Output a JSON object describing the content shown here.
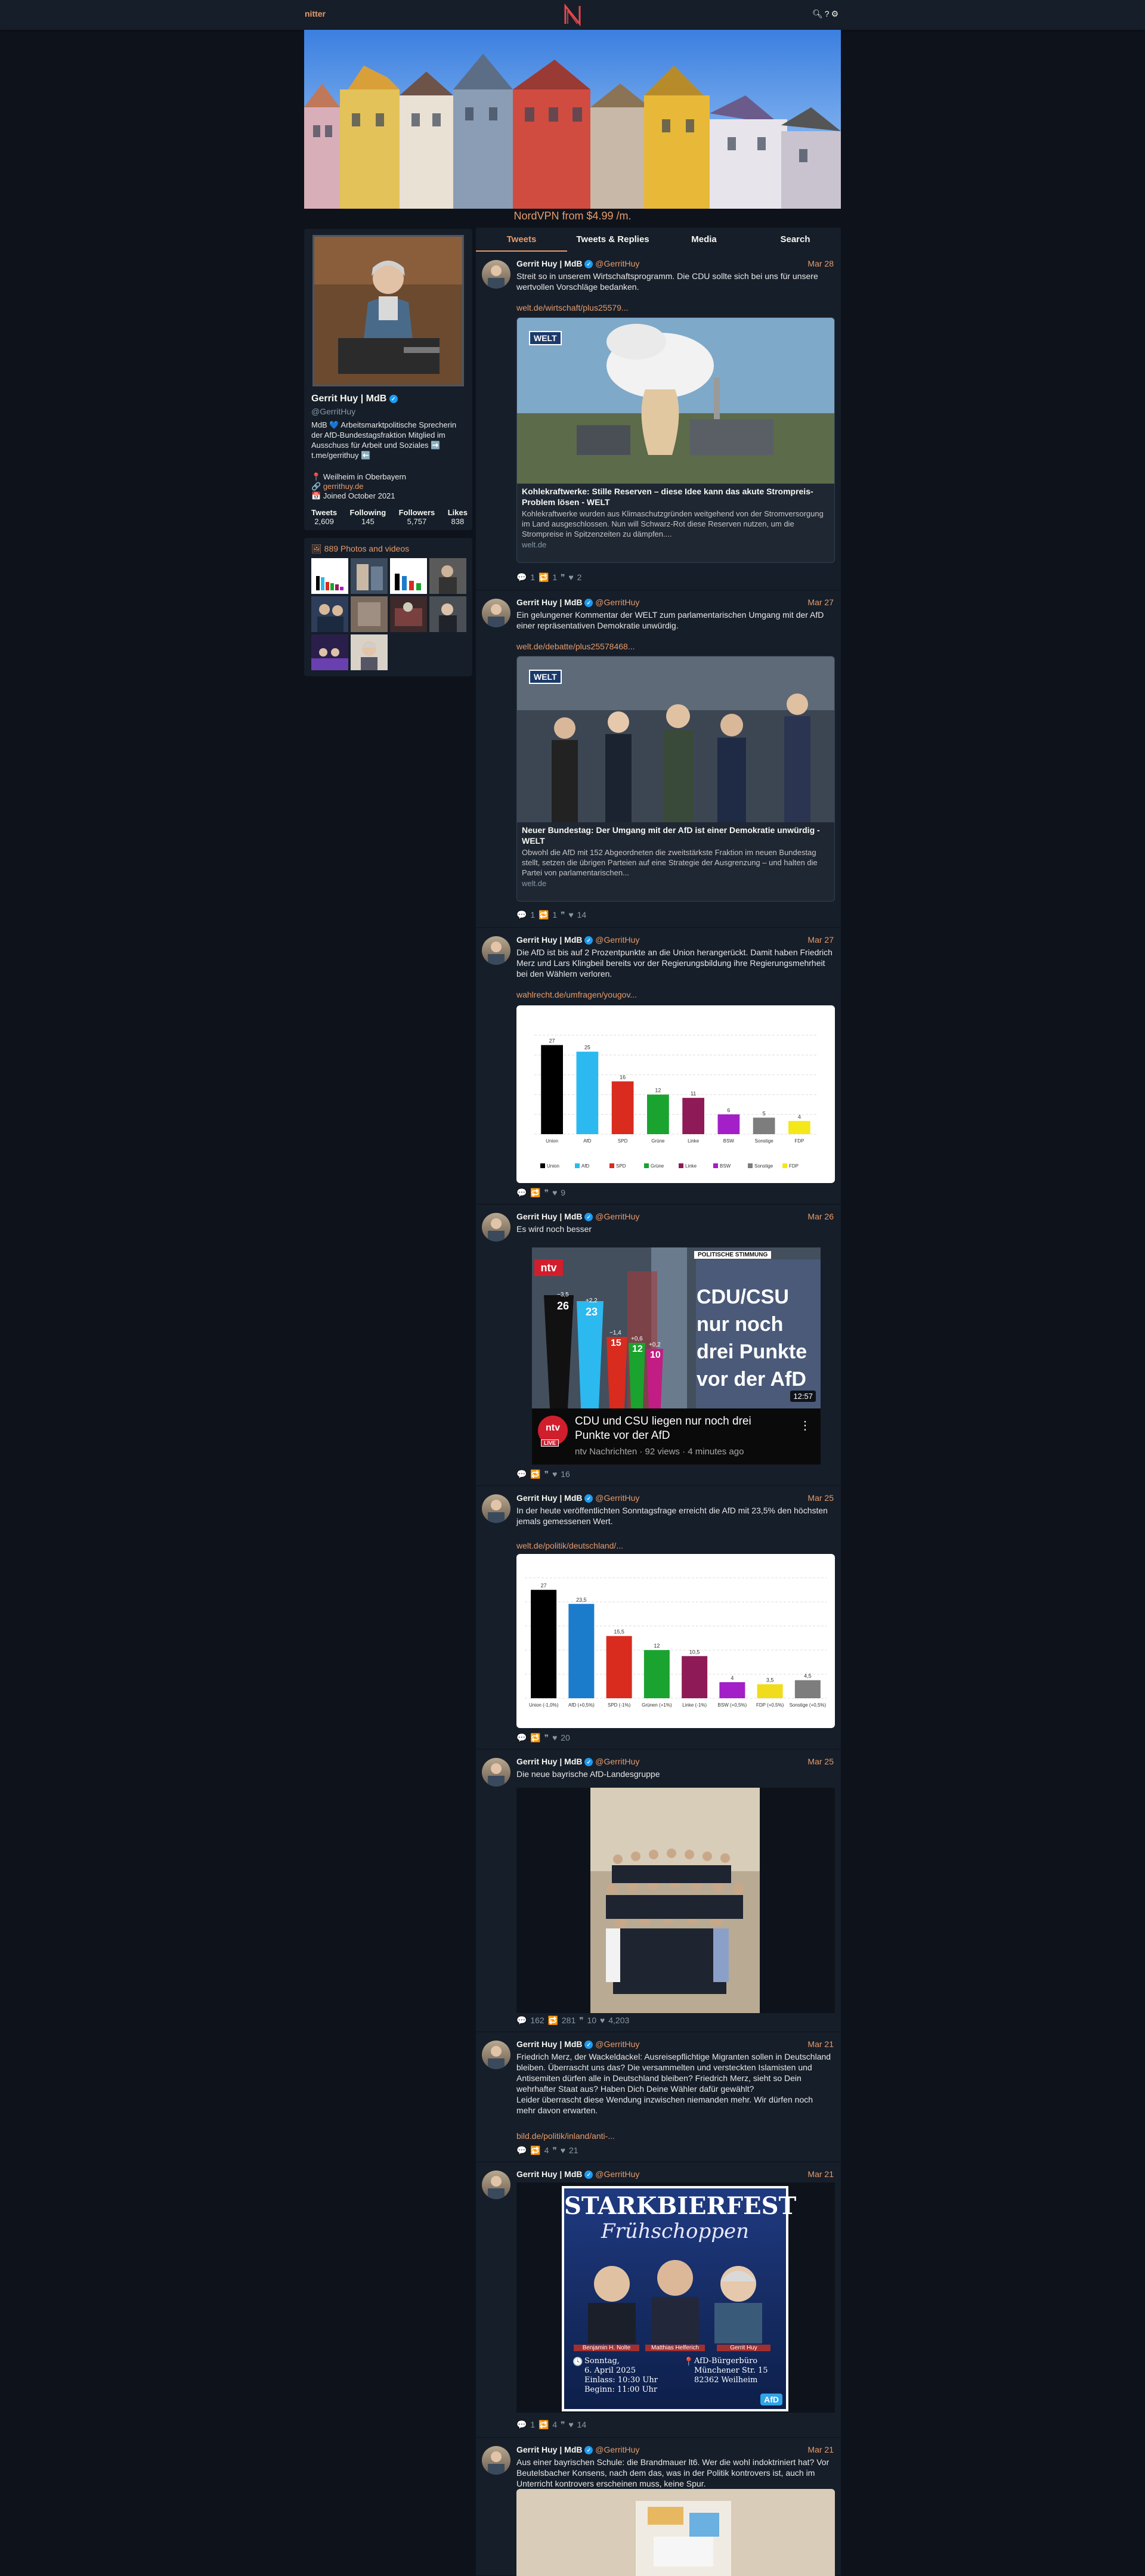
{
  "nav": {
    "brand": "nitter",
    "icons": [
      "search-icon",
      "help-icon",
      "settings-icon"
    ]
  },
  "promo": "NordVPN from $4.99 /m.",
  "tabs": [
    "Tweets",
    "Tweets & Replies",
    "Media",
    "Search"
  ],
  "profile": {
    "name": "Gerrit Huy | MdB",
    "handle": "@GerritHuy",
    "bio": "MdB 💙 Arbeitsmarktpolitische Sprecherin der AfD-Bundestagsfraktion Mitglied im Ausschuss für Arbeit und Soziales ➡️ t.me/gerrithuy ⬅️",
    "location": "Weilheim in Oberbayern",
    "website": "gerrithuy.de",
    "joined": "Joined October 2021",
    "stats": [
      {
        "label": "Tweets",
        "value": "2,609"
      },
      {
        "label": "Following",
        "value": "145"
      },
      {
        "label": "Followers",
        "value": "5,757"
      },
      {
        "label": "Likes",
        "value": "838"
      }
    ]
  },
  "media": {
    "title": "889 Photos and videos"
  },
  "tweets": [
    {
      "name": "Gerrit Huy | MdB",
      "handle": "@GerritHuy",
      "date": "Mar 28",
      "text": "Streit so in unserem Wirtschaftsprogramm. Die CDU sollte sich bei uns für unsere wertvollen Vorschläge bedanken.",
      "link": "welt.de/wirtschaft/plus25579...",
      "card": {
        "badge": "WELT",
        "title": "Kohlekraftwerke: Stille Reserven – diese Idee kann das akute Strompreis-Problem lösen - WELT",
        "desc": "Kohlekraftwerke wurden aus Klimaschutzgründen weitgehend von der Stromversorgung im Land ausgeschlossen. Nun will Schwarz-Rot diese Reserven nutzen, um die Strompreise in Spitzenzeiten zu dämpfen....",
        "domain": "welt.de"
      },
      "stats": "💬 1   🔁 1   ❞   ♥ 2"
    },
    {
      "name": "Gerrit Huy | MdB",
      "handle": "@GerritHuy",
      "date": "Mar 27",
      "text": "Ein gelungener Kommentar der WELT zum parlamentarischen Umgang mit der AfD einer repräsentativen Demokratie unwürdig.",
      "link": "welt.de/debatte/plus25578468...",
      "card": {
        "badge": "WELT",
        "title": "Neuer Bundestag: Der Umgang mit der AfD ist einer Demokratie unwürdig - WELT",
        "desc": "Obwohl die AfD mit 152 Abgeordneten die zweitstärkste Fraktion im neuen Bundestag stellt, setzen die übrigen Parteien auf eine Strategie der Ausgrenzung – und halten die Partei von parlamentarischen...",
        "domain": "welt.de"
      },
      "stats": "💬 1   🔁 1   ❞   ♥ 14"
    },
    {
      "name": "Gerrit Huy | MdB",
      "handle": "@GerritHuy",
      "date": "Mar 27",
      "text": "Die AfD ist bis auf 2 Prozentpunkte an die Union herangerückt. Damit haben Friedrich Merz und Lars Klingbeil bereits vor der Regierungsbildung ihre Regierungsmehrheit bei den Wählern verloren.",
      "link": "wahlrecht.de/umfragen/yougov...",
      "stats": "💬   🔁   ❞   ♥ 9"
    },
    {
      "name": "Gerrit Huy | MdB",
      "handle": "@GerritHuy",
      "date": "Mar 26",
      "text": "Es wird noch besser",
      "video": {
        "tag": "POLITISCHE STIMMUNG",
        "headline": "CDU/CSU nur noch drei Punkte vor der AfD",
        "duration": "12:57",
        "title": "CDU und CSU liegen nur noch drei Punkte vor der AfD",
        "meta": "ntv Nachrichten · 92 views · 4 minutes ago",
        "logo": "ntv",
        "live": "LIVE",
        "bars": [
          {
            "v": "26",
            "d": "−3,5"
          },
          {
            "v": "23",
            "d": "+2,2"
          },
          {
            "v": "15",
            "d": "−1,4"
          },
          {
            "v": "12",
            "d": "+0,6"
          },
          {
            "v": "10",
            "d": "+0,2"
          }
        ]
      },
      "stats": "💬   🔁   ❞   ♥ 16"
    },
    {
      "name": "Gerrit Huy | MdB",
      "handle": "@GerritHuy",
      "date": "Mar 25",
      "text": "In der heute veröffentlichten Sonntagsfrage erreicht die AfD mit 23,5% den höchsten jemals gemessenen Wert.",
      "link": "welt.de/politik/deutschland/...",
      "stats": "💬   🔁   ❞   ♥ 20"
    },
    {
      "name": "Gerrit Huy | MdB",
      "handle": "@GerritHuy",
      "date": "Mar 25",
      "text": "Die neue bayrische AfD-Landesgruppe",
      "stats": "💬 162   🔁 281   ❞ 10   ♥ 4,203"
    },
    {
      "name": "Gerrit Huy | MdB",
      "handle": "@GerritHuy",
      "date": "Mar 21",
      "text": "Friedrich Merz, der Wackeldackel: Ausreisepflichtige Migranten sollen in Deutschland bleiben. Überrascht uns das? Die versammelten und versteckten Islamisten und Antisemiten dürfen alle in Deutschland bleiben? Friedrich Merz, sieht so Dein wehrhafter Staat aus? Haben Dich Deine Wähler dafür gewählt?\nLeider überrascht diese Wendung inzwischen niemanden mehr. Wir dürfen noch mehr davon erwarten.",
      "link": "bild.de/politik/inland/anti-...",
      "stats": "💬   🔁 4   ❞   ♥ 21"
    },
    {
      "name": "Gerrit Huy | MdB",
      "handle": "@GerritHuy",
      "date": "Mar 21",
      "poster": {
        "title": "STARKBIERFEST",
        "subtitle": "Frühschoppen",
        "people": [
          "Benjamin H. Nolte",
          "Matthias Helferich",
          "Gerrit Huy"
        ],
        "when": "Sonntag,\n6. April 2025\nEinlass: 10:30 Uhr\nBeginn: 11:00 Uhr",
        "where": "AfD-Bürgerbüro\nMünchener Str. 15\n82362 Weilheim",
        "logo": "AfD"
      },
      "stats": "💬 1   🔁 4   ❞   ♥ 14"
    },
    {
      "name": "Gerrit Huy | MdB",
      "handle": "@GerritHuy",
      "date": "Mar 21",
      "text": "Aus einer bayrischen Schule: die Brandmauer lt6. Wer die wohl indoktriniert hat? Vor Beutelsbacher Konsens, nach dem das, was in der Politik kontrovers ist, auch im Unterricht kontrovers erscheinen muss, keine Spur."
    }
  ],
  "chart_data": [
    {
      "type": "bar",
      "title": "",
      "categories": [
        "Union",
        "AfD",
        "SPD",
        "Grüne",
        "Linke",
        "BSW",
        "Sonstige",
        "FDP"
      ],
      "values": [
        27,
        25,
        16,
        12,
        11,
        6,
        5,
        4
      ],
      "ylim": [
        0,
        30
      ],
      "colors": [
        "#000000",
        "#2cb9f0",
        "#d92b1e",
        "#1aa32e",
        "#8e1b57",
        "#a31fc7",
        "#7d7d7d",
        "#f4e81b"
      ]
    },
    {
      "type": "bar",
      "title": "",
      "categories": [
        "Union (-1,0%)",
        "AfD (+0,5%)",
        "SPD (-1%)",
        "Grünen (+1%)",
        "Linke (-1%)",
        "BSW (+0,5%)",
        "FDP (+0,5%)",
        "Sonstige (+0,5%)"
      ],
      "values": [
        27,
        23.5,
        15.5,
        12,
        10.5,
        4,
        3.5,
        4.5
      ],
      "ylim": [
        0,
        30
      ],
      "colors": [
        "#000000",
        "#1b7ccc",
        "#d92b1e",
        "#1aa32e",
        "#8e1b57",
        "#a31fc7",
        "#f0dc1c",
        "#7d7d7d"
      ]
    }
  ]
}
